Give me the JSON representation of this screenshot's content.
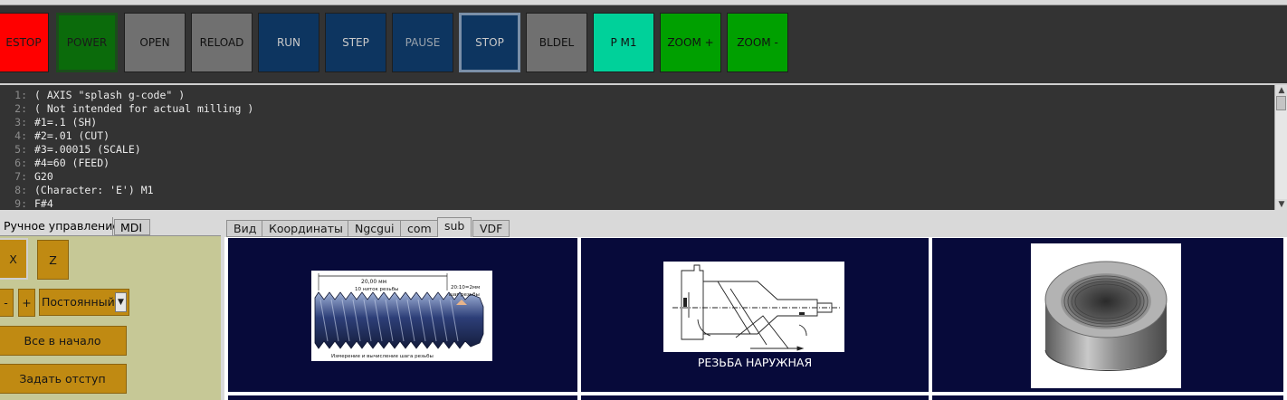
{
  "toolbar": {
    "buttons": [
      {
        "label": "ESTOP",
        "bg": "#ff0000"
      },
      {
        "label": "POWER",
        "bg": "#0b6b0b"
      },
      {
        "label": "OPEN",
        "bg": "#707070"
      },
      {
        "label": "RELOAD",
        "bg": "#707070"
      },
      {
        "label": "RUN",
        "bg": "#0d3560"
      },
      {
        "label": "STEP",
        "bg": "#0d3560"
      },
      {
        "label": "PAUSE",
        "bg": "#0d3560"
      },
      {
        "label": "STOP",
        "bg": "#0d3560"
      },
      {
        "label": "BLDEL",
        "bg": "#707070"
      },
      {
        "label": "P M1",
        "bg": "#00d19a"
      },
      {
        "label": "ZOOM +",
        "bg": "#00a000"
      },
      {
        "label": "ZOOM -",
        "bg": "#00a000"
      }
    ]
  },
  "gcode": {
    "lines": [
      {
        "num": "1:",
        "text": "( AXIS \"splash g-code\" )"
      },
      {
        "num": "2:",
        "text": "( Not intended for actual milling )"
      },
      {
        "num": "3:",
        "text": "#1=.1 (SH)"
      },
      {
        "num": "4:",
        "text": "#2=.01 (CUT)"
      },
      {
        "num": "5:",
        "text": "#3=.00015 (SCALE)"
      },
      {
        "num": "6:",
        "text": "#4=60 (FEED)"
      },
      {
        "num": "7:",
        "text": "G20"
      },
      {
        "num": "8:",
        "text": "(Character: 'E') M1"
      },
      {
        "num": "9:",
        "text": "F#4"
      }
    ]
  },
  "left_panel": {
    "tabs": [
      "Ручное управление",
      "MDI"
    ],
    "axis_x": "X",
    "axis_z": "Z",
    "minus": "-",
    "plus": "+",
    "jog_mode": "Постоянный",
    "home_all": "Все в начало",
    "set_offset": "Задать отступ"
  },
  "right_panel": {
    "tabs": [
      "Вид",
      "Координаты",
      "Ngcgui",
      "com",
      "sub",
      "VDF"
    ],
    "active_tab": "sub",
    "thread_drawing": {
      "dim_total": "20,00 мм",
      "dim_count": "10 ниток резьбы",
      "dim_ratio": "20:10=2мм",
      "dim_pitch": "шаг резьбы",
      "bottom_caption": "Измерение и вычисление шага резьбы"
    },
    "lathe_caption": "РЕЗЬБА НАРУЖНАЯ"
  }
}
